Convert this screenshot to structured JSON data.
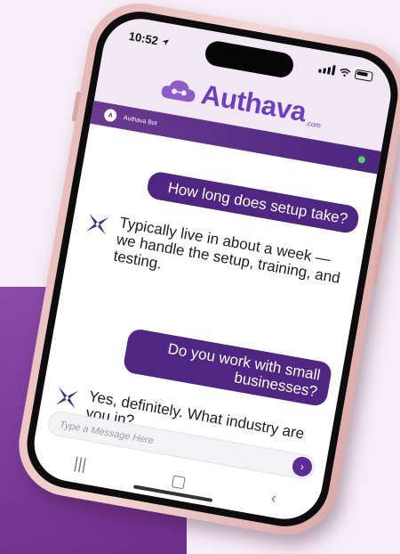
{
  "status": {
    "time": "10:52"
  },
  "brand": {
    "name": "Authava",
    "suffix": ".com",
    "color": "#6b3fc4"
  },
  "chat": {
    "bot_avatar_letter": "A",
    "bot_name": "Authava Bot",
    "online_color": "#4fd36a",
    "messages": [
      {
        "sender": "user",
        "text": "How long does setup take?"
      },
      {
        "sender": "bot",
        "text": "Typically live in about a week — we handle the setup, training, and testing."
      },
      {
        "sender": "user",
        "text": "Do you work with small businesses?"
      },
      {
        "sender": "bot",
        "text": "Yes, definitely. What industry are you in?"
      }
    ]
  },
  "input": {
    "placeholder": "Type a Message Here",
    "send_icon": "›"
  },
  "nav": {
    "recent": "|||",
    "home": "▢",
    "back": "‹"
  },
  "colors": {
    "accent": "#4f2782",
    "header": "#5a2d8a",
    "background": "#f6edf6",
    "block": "#7c3a9a"
  },
  "icons": [
    "location-arrow-icon",
    "signal-icon",
    "wifi-icon",
    "battery-icon",
    "cloud-logo-icon",
    "bot-star-icon",
    "send-icon"
  ]
}
